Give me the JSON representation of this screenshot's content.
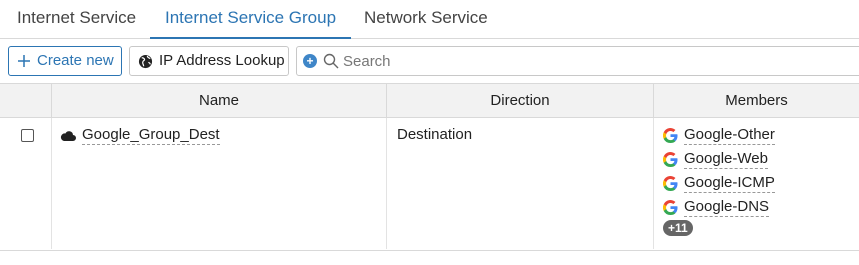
{
  "tabs": [
    {
      "label": "Internet Service",
      "active": false
    },
    {
      "label": "Internet Service Group",
      "active": true
    },
    {
      "label": "Network Service",
      "active": false
    }
  ],
  "toolbar": {
    "create_new_label": "Create new",
    "ip_lookup_label": "IP Address Lookup",
    "search_placeholder": "Search"
  },
  "table": {
    "columns": [
      "Name",
      "Direction",
      "Members"
    ],
    "rows": [
      {
        "name": "Google_Group_Dest",
        "direction": "Destination",
        "members": [
          "Google-Other",
          "Google-Web",
          "Google-ICMP",
          "Google-DNS"
        ],
        "more_badge": "+11"
      }
    ]
  },
  "colors": {
    "accent": "#2c75b3",
    "header_bg": "#f2f2f2",
    "badge_bg": "#666666"
  },
  "icons": {
    "create": "plus-icon",
    "lookup": "globe-icon",
    "search": "search-icon",
    "group": "cloud-icon",
    "member": "google-g-icon"
  }
}
